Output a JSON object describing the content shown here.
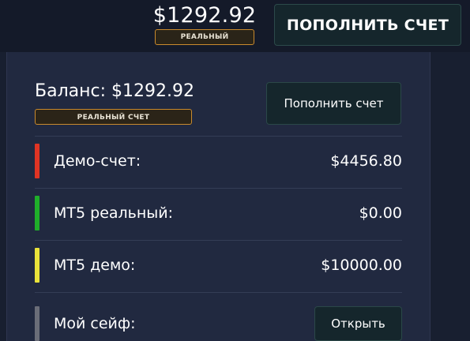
{
  "header": {
    "balance": "$1292.92",
    "account_type": "РЕАЛЬНЫЙ",
    "topup_label": "ПОПОЛНИТЬ СЧЕТ"
  },
  "dropdown": {
    "balance_label": "Баланс: $1292.92",
    "account_type": "РЕАЛЬНЫЙ СЧЕТ",
    "topup_label": "Пополнить счет",
    "accounts": [
      {
        "name": "Демо-счет:",
        "value": "$4456.80",
        "color": "#e03424"
      },
      {
        "name": "MT5 реальный:",
        "value": "$0.00",
        "color": "#1fae2a"
      },
      {
        "name": "MT5 демо:",
        "value": "$10000.00",
        "color": "#e9e23a"
      },
      {
        "name": "Мой сейф:",
        "action_label": "Открыть",
        "color": "#6a6d78"
      }
    ]
  },
  "colors": {
    "background": "#141a29",
    "panel": "#212940",
    "badge_border": "#c98a2d",
    "button_bg": "#15262c"
  }
}
